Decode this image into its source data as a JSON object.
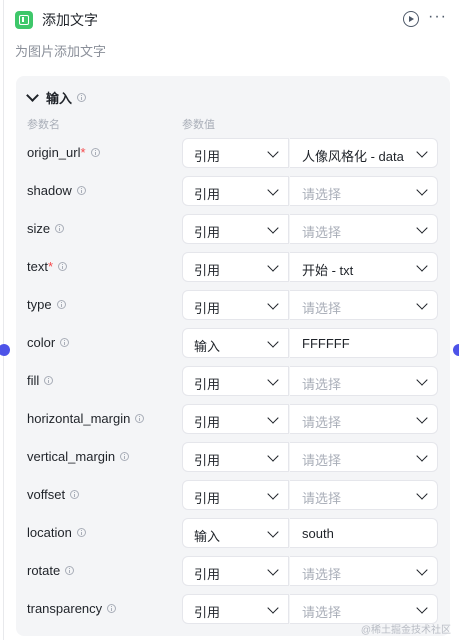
{
  "node": {
    "title": "添加文字",
    "description": "为图片添加文字",
    "icon": "text-node-icon"
  },
  "section": {
    "title": "输入"
  },
  "columns": {
    "name": "参数名",
    "value": "参数值"
  },
  "rows": [
    {
      "name": "origin_url",
      "required": "*",
      "mode": "引用",
      "value": "人像风格化 - data",
      "placeholder": "",
      "value_has_dropdown": true
    },
    {
      "name": "shadow",
      "required": "",
      "mode": "引用",
      "value": "",
      "placeholder": "请选择",
      "value_has_dropdown": true
    },
    {
      "name": "size",
      "required": "",
      "mode": "引用",
      "value": "",
      "placeholder": "请选择",
      "value_has_dropdown": true
    },
    {
      "name": "text",
      "required": "*",
      "mode": "引用",
      "value": "开始 - txt",
      "placeholder": "",
      "value_has_dropdown": true
    },
    {
      "name": "type",
      "required": "",
      "mode": "引用",
      "value": "",
      "placeholder": "请选择",
      "value_has_dropdown": true
    },
    {
      "name": "color",
      "required": "",
      "mode": "输入",
      "value": "FFFFFF",
      "placeholder": "",
      "value_has_dropdown": false
    },
    {
      "name": "fill",
      "required": "",
      "mode": "引用",
      "value": "",
      "placeholder": "请选择",
      "value_has_dropdown": true
    },
    {
      "name": "horizontal_margin",
      "required": "",
      "mode": "引用",
      "value": "",
      "placeholder": "请选择",
      "value_has_dropdown": true
    },
    {
      "name": "vertical_margin",
      "required": "",
      "mode": "引用",
      "value": "",
      "placeholder": "请选择",
      "value_has_dropdown": true
    },
    {
      "name": "voffset",
      "required": "",
      "mode": "引用",
      "value": "",
      "placeholder": "请选择",
      "value_has_dropdown": true
    },
    {
      "name": "location",
      "required": "",
      "mode": "输入",
      "value": "south",
      "placeholder": "",
      "value_has_dropdown": false
    },
    {
      "name": "rotate",
      "required": "",
      "mode": "引用",
      "value": "",
      "placeholder": "请选择",
      "value_has_dropdown": true
    },
    {
      "name": "transparency",
      "required": "",
      "mode": "引用",
      "value": "",
      "placeholder": "请选择",
      "value_has_dropdown": true
    }
  ],
  "watermark": "@稀土掘金技术社区",
  "colors": {
    "accent": "#4d53e8",
    "node_icon": "#3ec76a",
    "required": "#f5484a"
  }
}
